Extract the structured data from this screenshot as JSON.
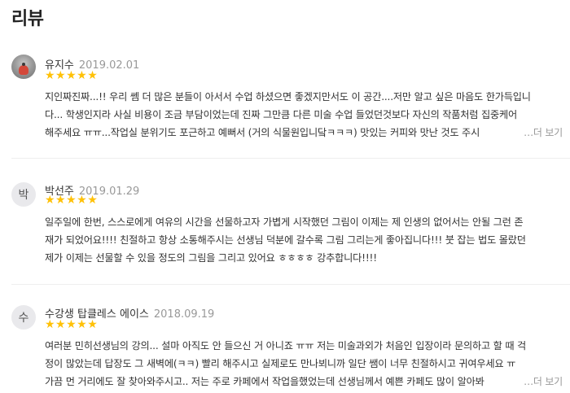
{
  "section_title": "리뷰",
  "more_label": "…더 보기",
  "star_color": "#ffc107",
  "reviews": [
    {
      "avatar_type": "photo",
      "avatar_text": "",
      "name": "유지수",
      "date": "2019.02.01",
      "rating": "★★★★★",
      "lines": [
        "지인짜진짜...!! 우리 쏌 더 많은 분들이 아서서 수업 하셨으면 좋겠지만서도 이 공간....저만 알고 싶은 마음도 한가득입니",
        "다... 학생인지라 사실 비용이 조금 부담이었는데 진짜 그만큼 다른 미술 수업 들었던것보다 자신의 작품처럼 집중케어",
        "해주세요 ㅠㅠ...작업실 분위기도 포근하고 예뻐서 (거의 식물원입니닼ㅋㅋㅋ) 맛있는 커피와 맛난 것도 주시"
      ],
      "has_more": true
    },
    {
      "avatar_type": "initial",
      "avatar_text": "박",
      "name": "박선주",
      "date": "2019.01.29",
      "rating": "★★★★★",
      "lines": [
        "일주일에 한번, 스스로에게 여유의 시간을 선물하고자 가볍게 시작했던 그림이 이제는 제 인생의 없어서는 안될 그런 존",
        "재가 되었어요!!!! 친절하고 항상 소통해주시는 선생님 덕분에 갈수록 그림 그리는게 좋아집니다!!! 붓 잡는 법도 몰랐던",
        "제가 이제는 선물할 수 있을 정도의 그림을 그리고 있어요 ㅎㅎㅎㅎ 강추합니다!!!!"
      ],
      "has_more": false
    },
    {
      "avatar_type": "initial",
      "avatar_text": "수",
      "name": "수강생 탑클레스 에이스",
      "date": "2018.09.19",
      "rating": "★★★★★",
      "lines": [
        "여러분 민히선생님의 강의... 설마 아직도 안 들으신 거 아니죠 ㅠㅠ 저는 미술과외가 처음인 입장이라 문의하고 할 때 걱",
        "정이 많았는데 답장도 그 새벽에(ㅋㅋ) 빨리 해주시고 실제로도 만나뵈니까 일단 쌤이 너무 친절하시고 귀여우세요 ㅠ",
        "가끔 먼 거리에도 잘 찾아와주시고.. 저는 주로 카페에서 작업을했었는데 선생님께서 예쁜 카페도 많이 알아봐"
      ],
      "has_more": true
    }
  ]
}
